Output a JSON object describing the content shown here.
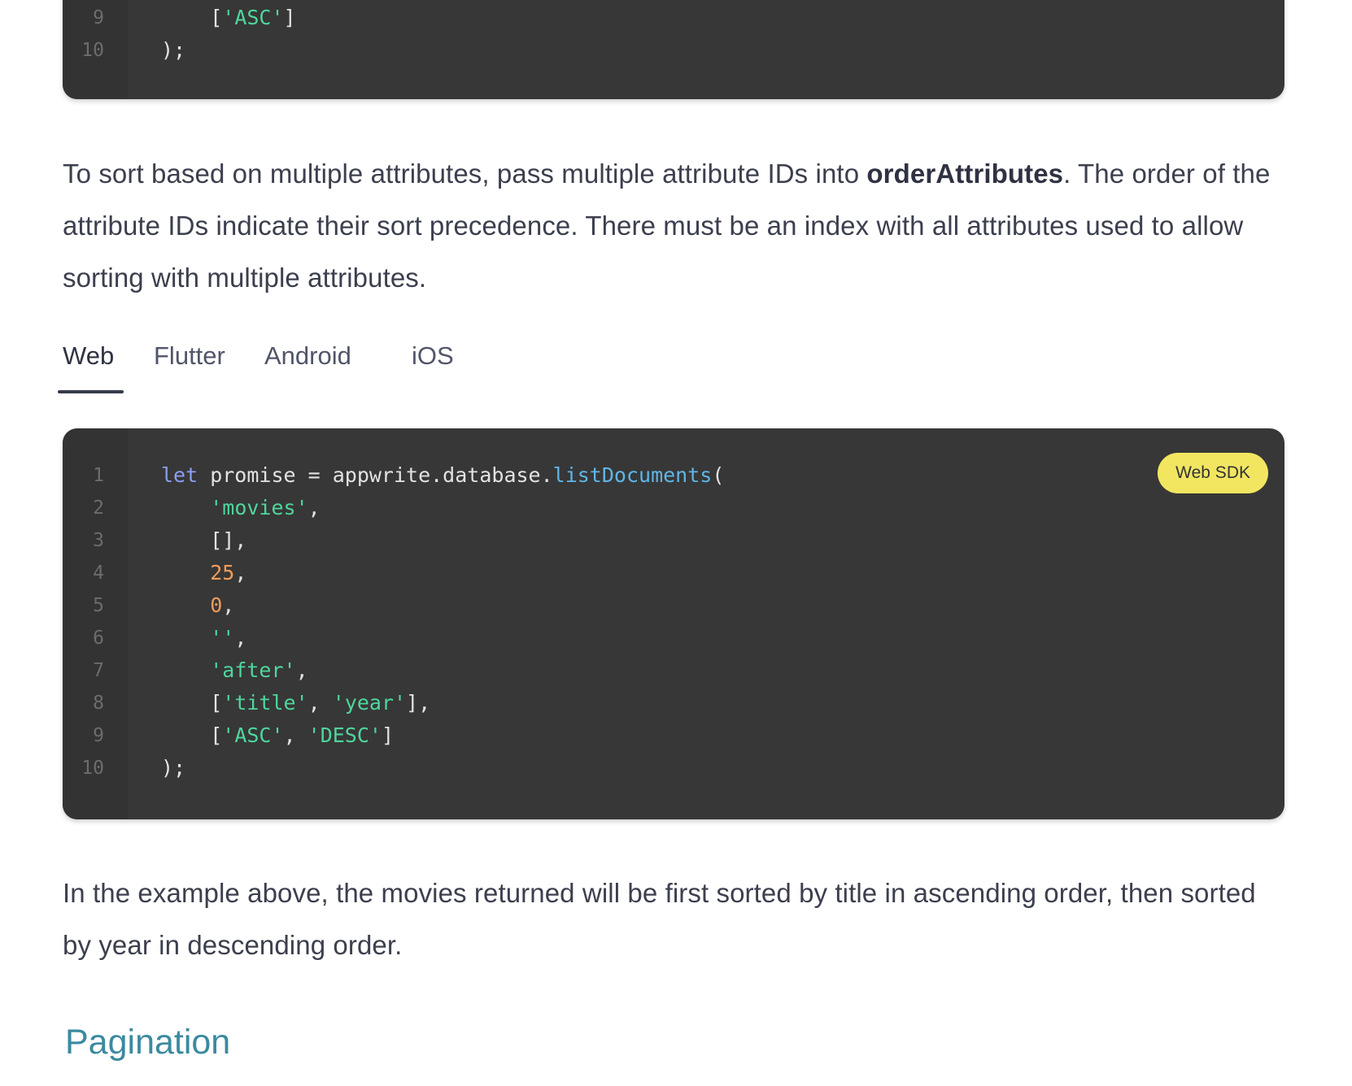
{
  "top_code": {
    "lines": [
      {
        "num": "9",
        "tokens": [
          {
            "t": "    [",
            "c": "txt"
          },
          {
            "t": "'ASC'",
            "c": "str"
          },
          {
            "t": "]",
            "c": "txt"
          }
        ]
      },
      {
        "num": "10",
        "tokens": [
          {
            "t": ");",
            "c": "txt"
          }
        ]
      }
    ]
  },
  "para_1": {
    "before": "To sort based on multiple attributes, pass multiple attribute IDs into ",
    "bold": "orderAttributes",
    "after": ". The order of the attribute IDs indicate their sort precedence. There must be an index with all attributes used to allow sorting with multiple attributes."
  },
  "tabs": [
    {
      "label": "Web",
      "active": true
    },
    {
      "label": "Flutter",
      "active": false
    },
    {
      "label": "Android",
      "active": false
    },
    {
      "label": "iOS",
      "active": false
    }
  ],
  "main_code": {
    "badge": "Web SDK",
    "lines": [
      {
        "num": "1",
        "tokens": [
          {
            "t": "let",
            "c": "kw"
          },
          {
            "t": " promise = appwrite.database.",
            "c": "txt"
          },
          {
            "t": "listDocuments",
            "c": "fn"
          },
          {
            "t": "(",
            "c": "txt"
          }
        ]
      },
      {
        "num": "2",
        "tokens": [
          {
            "t": "    ",
            "c": "txt"
          },
          {
            "t": "'movies'",
            "c": "str"
          },
          {
            "t": ",",
            "c": "txt"
          }
        ]
      },
      {
        "num": "3",
        "tokens": [
          {
            "t": "    [],",
            "c": "txt"
          }
        ]
      },
      {
        "num": "4",
        "tokens": [
          {
            "t": "    ",
            "c": "txt"
          },
          {
            "t": "25",
            "c": "num"
          },
          {
            "t": ",",
            "c": "txt"
          }
        ]
      },
      {
        "num": "5",
        "tokens": [
          {
            "t": "    ",
            "c": "txt"
          },
          {
            "t": "0",
            "c": "num"
          },
          {
            "t": ",",
            "c": "txt"
          }
        ]
      },
      {
        "num": "6",
        "tokens": [
          {
            "t": "    ",
            "c": "txt"
          },
          {
            "t": "''",
            "c": "str"
          },
          {
            "t": ",",
            "c": "txt"
          }
        ]
      },
      {
        "num": "7",
        "tokens": [
          {
            "t": "    ",
            "c": "txt"
          },
          {
            "t": "'after'",
            "c": "str"
          },
          {
            "t": ",",
            "c": "txt"
          }
        ]
      },
      {
        "num": "8",
        "tokens": [
          {
            "t": "    [",
            "c": "txt"
          },
          {
            "t": "'title'",
            "c": "str"
          },
          {
            "t": ", ",
            "c": "txt"
          },
          {
            "t": "'year'",
            "c": "str"
          },
          {
            "t": "],",
            "c": "txt"
          }
        ]
      },
      {
        "num": "9",
        "tokens": [
          {
            "t": "    [",
            "c": "txt"
          },
          {
            "t": "'ASC'",
            "c": "str"
          },
          {
            "t": ", ",
            "c": "txt"
          },
          {
            "t": "'DESC'",
            "c": "str"
          },
          {
            "t": "]",
            "c": "txt"
          }
        ]
      },
      {
        "num": "10",
        "tokens": [
          {
            "t": ");",
            "c": "txt"
          }
        ]
      }
    ]
  },
  "para_2": {
    "text": "In the example above, the movies returned will be first sorted by title in ascending order, then sorted by year in descending order."
  },
  "section_heading": "Pagination",
  "colors": {
    "code_bg": "#373737",
    "keyword": "#8c9ef2",
    "function": "#5fb6e6",
    "string": "#4fd69c",
    "number": "#f29c5a",
    "badge_bg": "#f2e661",
    "heading": "#3b8aa0"
  }
}
